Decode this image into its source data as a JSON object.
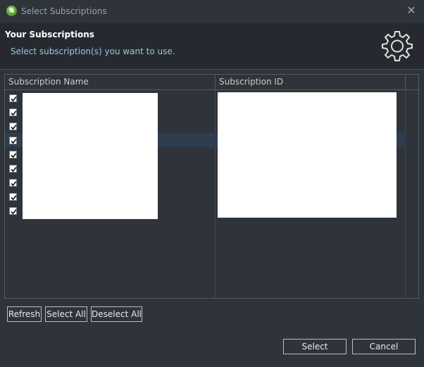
{
  "window": {
    "title": "Select Subscriptions",
    "app_icon": "spring-leaf-icon",
    "close_icon": "close-icon"
  },
  "header": {
    "title": "Your Subscriptions",
    "subtitle": "Select subscription(s) you want to use.",
    "icon": "gear-icon"
  },
  "table": {
    "columns": [
      "Subscription Name",
      "Subscription ID"
    ],
    "rows": [
      {
        "checked": true,
        "name": "",
        "id": ""
      },
      {
        "checked": true,
        "name": "",
        "id": ""
      },
      {
        "checked": true,
        "name": "",
        "id": ""
      },
      {
        "checked": true,
        "name": "",
        "id": ""
      },
      {
        "checked": true,
        "name": "",
        "id": ""
      },
      {
        "checked": true,
        "name": "",
        "id": ""
      },
      {
        "checked": true,
        "name": "",
        "id": ""
      },
      {
        "checked": true,
        "name": "",
        "id": ""
      },
      {
        "checked": true,
        "name": "",
        "id": ""
      }
    ]
  },
  "actions": {
    "refresh": "Refresh",
    "select_all": "Select All",
    "deselect_all": "Deselect All",
    "select": "Select",
    "cancel": "Cancel"
  },
  "colors": {
    "background": "#2f343b",
    "header_bg": "#262a30",
    "selected_row": "#2d3e4f",
    "subtitle": "#9cc4dc"
  }
}
